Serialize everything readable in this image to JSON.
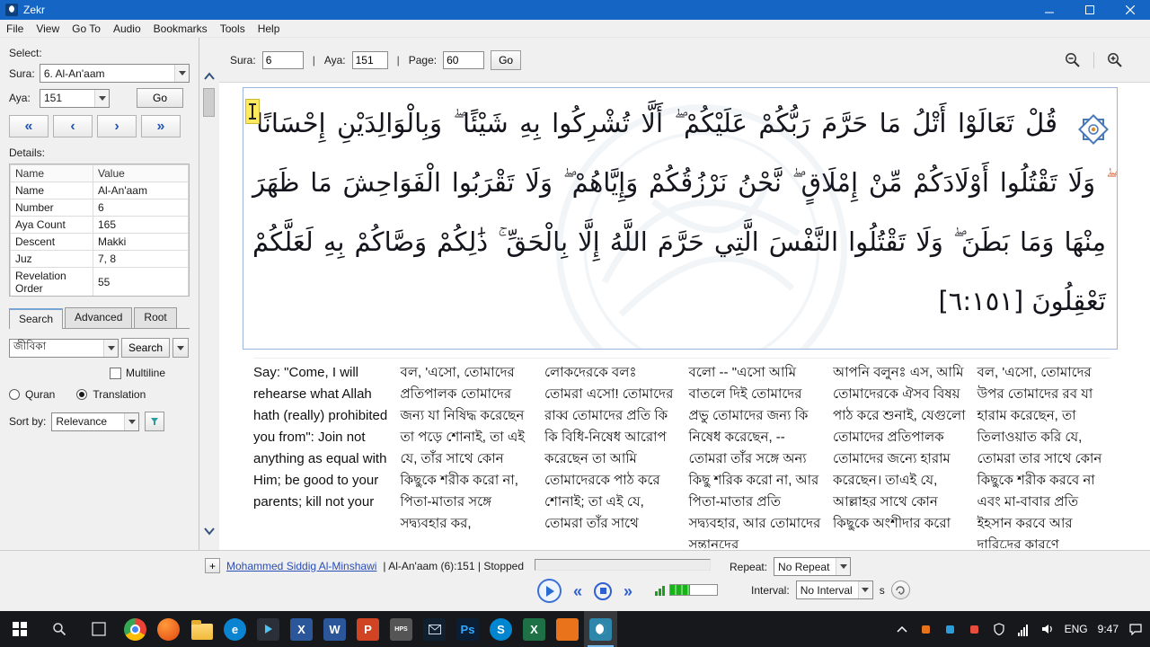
{
  "window": {
    "title": "Zekr"
  },
  "menu": {
    "items": [
      "File",
      "View",
      "Go To",
      "Audio",
      "Bookmarks",
      "Tools",
      "Help"
    ]
  },
  "sidebar": {
    "select_label": "Select:",
    "sura_label": "Sura:",
    "sura_value": "6. Al-An'aam",
    "aya_label": "Aya:",
    "aya_value": "151",
    "go_label": "Go",
    "nav": {
      "first": "«",
      "prev": "‹",
      "next": "›",
      "last": "»"
    },
    "details_label": "Details:",
    "details": {
      "headers": [
        "Name",
        "Value"
      ],
      "rows": [
        [
          "Name",
          "Al-An'aam"
        ],
        [
          "Number",
          "6"
        ],
        [
          "Aya Count",
          "165"
        ],
        [
          "Descent",
          "Makki"
        ],
        [
          "Juz",
          "7, 8"
        ],
        [
          "Revelation Order",
          "55"
        ]
      ]
    },
    "tabs": [
      "Search",
      "Advanced",
      "Root"
    ],
    "search": {
      "query": "জীবিকা",
      "button": "Search",
      "multiline": "Multiline",
      "scope_quran": "Quran",
      "scope_translation": "Translation",
      "sort_label": "Sort by:",
      "sort_value": "Relevance"
    }
  },
  "toolbar": {
    "sura_label": "Sura:",
    "sura_value": "6",
    "aya_label": "Aya:",
    "aya_value": "151",
    "page_label": "Page:",
    "page_value": "60",
    "go_label": "Go",
    "separator": "|"
  },
  "quran": {
    "lines": [
      "قُلْ تَعَالَوْا أَتْلُ مَا حَرَّمَ رَبُّكُمْ عَلَيْكُمْ ۖ أَلَّا تُشْرِكُوا بِهِ شَيْئًا ۖ وَبِالْوَالِدَيْنِ إِحْسَانًا",
      "ۖ وَلَا تَقْتُلُوا أَوْلَادَكُمْ مِّنْ إِمْلَاقٍ ۖ نَّحْنُ نَرْزُقُكُمْ وَإِيَّاهُمْ ۖ وَلَا تَقْرَبُوا الْفَوَاحِشَ مَا ظَهَرَ",
      "مِنْهَا وَمَا بَطَنَ ۖ وَلَا تَقْتُلُوا النَّفْسَ الَّتِي حَرَّمَ اللَّهُ إِلَّا بِالْحَقِّ ۚ ذَٰلِكُمْ وَصَّاكُمْ بِهِ لَعَلَّكُمْ",
      "تَعْقِلُونَ [٦:١٥١]"
    ]
  },
  "translations": [
    "Say: \"Come, I will rehearse what Allah hath (really) prohibited you from\": Join not anything as equal with Him; be good to your parents; kill not your",
    "বল, 'এসো, তোমাদের প্রতিপালক তোমাদের জন্য যা নিষিদ্ধ করেছেন তা পড়ে শোনাই, তা এই যে, তাঁর সাথে কোন কিছুকে শরীক করো না, পিতা-মাতার সঙ্গে সদ্ব্যবহার কর,",
    "লোকদেরকে বলঃ তোমরা এসো! তোমাদের রাব্ব তোমাদের প্রতি কি কি বিধি-নিষেধ আরোপ করেছেন তা আমি তোমাদেরকে পাঠ করে শোনাই; তা এই যে, তোমরা তাঁর সাথে",
    "বলো -- \"এসো আমি বাতলে দিই তোমাদের প্রভু তোমাদের জন্য কি নিষেধ করেছেন, -- তোমরা তাঁর সঙ্গে অন্য কিছু শরিক করো না, আর পিতা-মাতার প্রতি সদ্ব্যবহার, আর তোমাদের সন্তানদের",
    "আপনি বলুনঃ এস, আমি তোমাদেরকে ঐসব বিষয় পাঠ করে শুনাই, যেগুলো তোমাদের প্রতিপালক তোমাদের জন্যে হারাম করেছেন। তাএই যে, আল্লাহর সাথে কোন কিছুকে অংশীদার করো",
    "বল, 'এসো, তোমাদের উপর তোমাদের রব যা হারাম করেছেন, তা তিলাওয়াত করি যে, তোমরা তার সাথে কোন কিছুকে শরীক করবে না এবং মা-বাবার প্রতি ইহসান করবে আর দারিদ্রের কারণে"
  ],
  "audio": {
    "add_label": "+",
    "reciter_link": "Mohammed Siddig Al-Minshawi",
    "status": "| Al-An'aam (6):151 | Stopped",
    "repeat_label": "Repeat:",
    "repeat_value": "No Repeat",
    "interval_label": "Interval:",
    "interval_value": "No Interval",
    "interval_unit": "s",
    "controls": {
      "prev": "«",
      "next": "»"
    }
  },
  "taskbar": {
    "lang": "ENG",
    "time": "9:47",
    "apps": [
      {
        "name": "chrome"
      },
      {
        "name": "browser-red"
      },
      {
        "name": "file-explorer"
      },
      {
        "name": "edge",
        "label": "e"
      },
      {
        "name": "media-player"
      },
      {
        "name": "office-x",
        "label": "X"
      },
      {
        "name": "word",
        "label": "W"
      },
      {
        "name": "powerpoint",
        "label": "P"
      },
      {
        "name": "hps",
        "label": "HPS"
      },
      {
        "name": "mail"
      },
      {
        "name": "photoshop",
        "label": "Ps"
      },
      {
        "name": "skype",
        "label": "S"
      },
      {
        "name": "excel",
        "label": "X"
      },
      {
        "name": "orange-app"
      },
      {
        "name": "zekr",
        "active": true
      }
    ]
  },
  "colors": {
    "titlebar": "#1566c4",
    "accent_blue": "#2f5fd0",
    "waqf_orange": "#cf5b2e",
    "volume_green": "#19b219"
  }
}
